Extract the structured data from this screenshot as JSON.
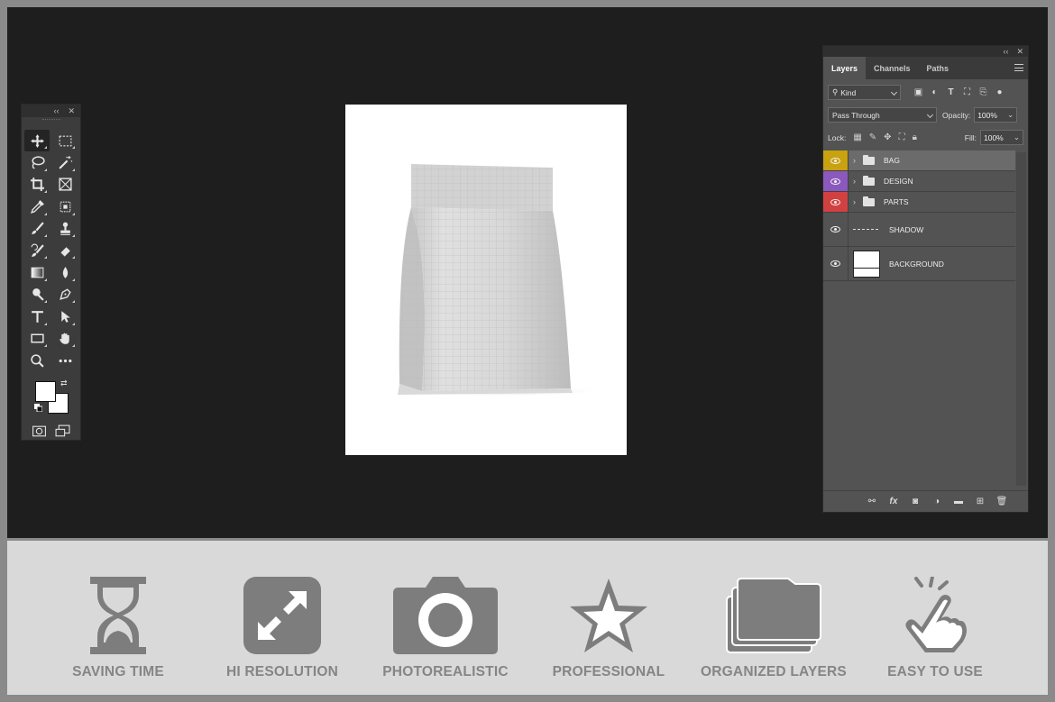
{
  "tools_panel": {
    "collapse_label": "‹‹",
    "close_label": "✕",
    "tools": [
      "move-tool",
      "marquee-tool",
      "lasso-tool",
      "magic-wand-tool",
      "crop-tool",
      "frame-tool",
      "eyedropper-tool",
      "object-selection-tool",
      "brush-tool",
      "stamp-tool",
      "history-brush-tool",
      "eraser-tool",
      "gradient-tool",
      "blur-tool",
      "dodge-tool",
      "pen-tool",
      "type-tool",
      "path-selection-tool",
      "rectangle-tool",
      "hand-tool",
      "zoom-tool",
      "more-tools"
    ],
    "foreground_color": "#ffffff",
    "background_color": "#ffffff"
  },
  "document": {
    "background": "#ffffff",
    "content": "pouch-bag-mockup"
  },
  "layers_panel": {
    "collapse_label": "‹‹",
    "close_label": "✕",
    "tabs": [
      {
        "label": "Layers",
        "active": true
      },
      {
        "label": "Channels",
        "active": false
      },
      {
        "label": "Paths",
        "active": false
      }
    ],
    "filter_kind": "Kind",
    "blend_mode": "Pass Through",
    "opacity_label": "Opacity:",
    "opacity_value": "100%",
    "lock_label": "Lock:",
    "fill_label": "Fill:",
    "fill_value": "100%",
    "layers": [
      {
        "name": "BAG",
        "type": "group",
        "color": "#c8a20f",
        "selected": true
      },
      {
        "name": "DESIGN",
        "type": "group",
        "color": "#8b59bd",
        "selected": false
      },
      {
        "name": "PARTS",
        "type": "group",
        "color": "#d24141",
        "selected": false
      },
      {
        "name": "SHADOW",
        "type": "layer",
        "color": "",
        "selected": false
      },
      {
        "name": "BACKGROUND",
        "type": "layer",
        "color": "",
        "selected": false
      }
    ]
  },
  "features": [
    {
      "label": "SAVING TIME",
      "icon": "hourglass-icon"
    },
    {
      "label": "HI RESOLUTION",
      "icon": "expand-icon"
    },
    {
      "label": "PHOTOREALISTIC",
      "icon": "camera-icon"
    },
    {
      "label": "PROFESSIONAL",
      "icon": "star-icon"
    },
    {
      "label": "ORGANIZED LAYERS",
      "icon": "folders-icon"
    },
    {
      "label": "EASY TO USE",
      "icon": "tap-hand-icon"
    }
  ]
}
